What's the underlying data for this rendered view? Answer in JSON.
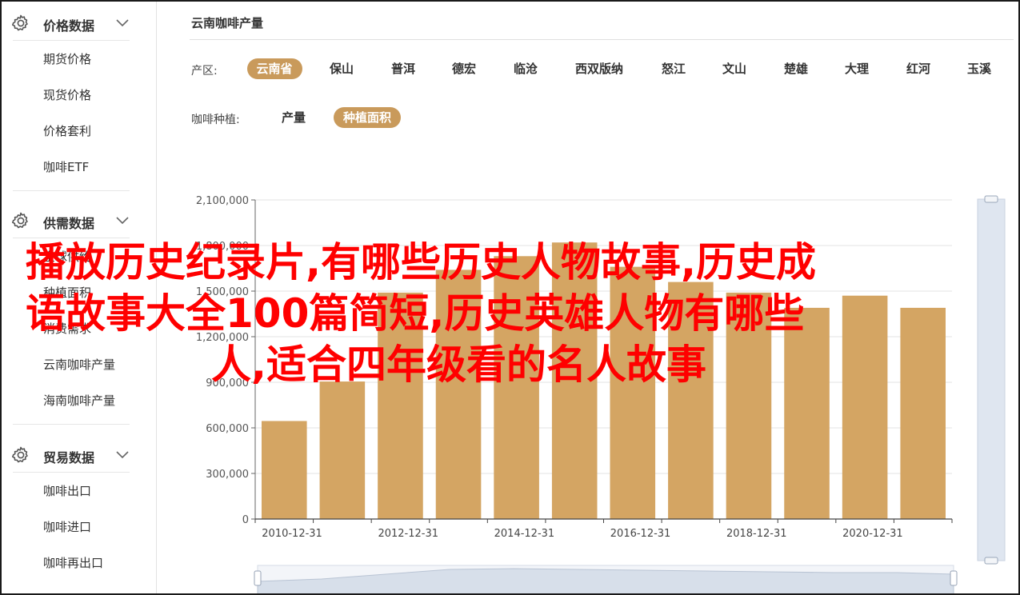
{
  "sidebar": {
    "groups": [
      {
        "title": "价格数据",
        "icon": "gear-icon",
        "items": [
          "期货价格",
          "现货价格",
          "价格套利",
          "咖啡ETF"
        ]
      },
      {
        "title": "供需数据",
        "icon": "gear-icon",
        "items": [
          "全球供给",
          "种植面积",
          "消费需求",
          "云南咖啡产量",
          "海南咖啡产量"
        ]
      },
      {
        "title": "贸易数据",
        "icon": "gear-icon",
        "items": [
          "咖啡出口",
          "咖啡进口",
          "咖啡再出口"
        ]
      }
    ]
  },
  "main": {
    "title": "云南咖啡产量",
    "filters": {
      "region_label": "产区:",
      "regions": [
        "云南省",
        "保山",
        "普洱",
        "德宏",
        "临沧",
        "西双版纳",
        "怒江",
        "文山",
        "楚雄",
        "大理",
        "红河",
        "玉溪"
      ],
      "region_selected": "云南省",
      "metric_label": "咖啡种植:",
      "metrics": [
        "产量",
        "种植面积"
      ],
      "metric_selected": "种植面积"
    }
  },
  "colors": {
    "accent": "#c99a5b",
    "bar": "#d4a563",
    "overlay_text": "#ff0000"
  },
  "chart_data": {
    "type": "bar",
    "categories": [
      "2010-12-31",
      "2011-12-31",
      "2012-12-31",
      "2013-12-31",
      "2014-12-31",
      "2015-12-31",
      "2016-12-31",
      "2017-12-31",
      "2018-12-31",
      "2019-12-31",
      "2020-12-31",
      "2021-12-31"
    ],
    "x_tick_labels": [
      "2010-12-31",
      "2012-12-31",
      "2014-12-31",
      "2016-12-31",
      "2018-12-31",
      "2020-12-31"
    ],
    "values": [
      645000,
      905000,
      1490000,
      1640000,
      1730000,
      1820000,
      1660000,
      1560000,
      1490000,
      1390000,
      1470000,
      1390000
    ],
    "y_tick_labels": [
      "0",
      "300,000",
      "600,000",
      "900,000",
      "1,200,000",
      "1,500,000",
      "1,800,000",
      "2,100,000"
    ],
    "ylim": [
      0,
      2100000
    ],
    "grid": true,
    "datazoom": "bottom"
  },
  "overlay": {
    "lines": [
      "播放历史纪录片,有哪些历史人物故事,历史成",
      "语故事大全100篇简短,历史英雄人物有哪些",
      "人,适合四年级看的名人故事"
    ]
  }
}
